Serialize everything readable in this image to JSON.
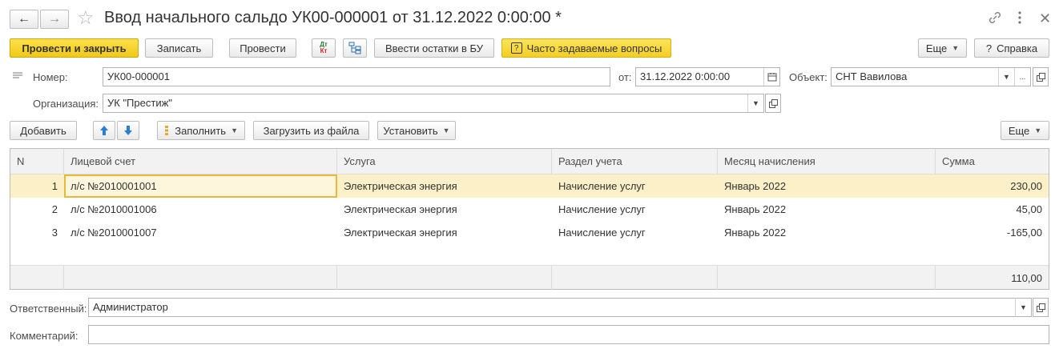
{
  "window": {
    "title": "Ввод начального сальдо УК00-000001 от 31.12.2022 0:00:00 *"
  },
  "toolbar": {
    "post_close": "Провести и закрыть",
    "write": "Записать",
    "post": "Провести",
    "dt_kt_icon": "dt-kt-icon",
    "structure_icon": "structure-icon",
    "enter_balances": "Ввести остатки в БУ",
    "faq": "Часто задаваемые вопросы",
    "more": "Еще",
    "help": "Справка"
  },
  "header": {
    "number_label": "Номер:",
    "number_value": "УК00-000001",
    "from_label": "от:",
    "date_value": "31.12.2022  0:00:00",
    "object_label": "Объект:",
    "object_value": "СНТ Вавилова",
    "org_label": "Организация:",
    "org_value": "УК \"Престиж\""
  },
  "table_toolbar": {
    "add": "Добавить",
    "fill": "Заполнить",
    "load_file": "Загрузить из файла",
    "set": "Установить",
    "more": "Еще"
  },
  "table": {
    "columns": [
      "N",
      "Лицевой счет",
      "Услуга",
      "Раздел учета",
      "Месяц начисления",
      "Сумма"
    ],
    "rows": [
      {
        "n": "1",
        "account": "л/с №2010001001",
        "service": "Электрическая энергия",
        "section": "Начисление услуг",
        "month": "Январь 2022",
        "sum": "230,00"
      },
      {
        "n": "2",
        "account": "л/с №2010001006",
        "service": "Электрическая энергия",
        "section": "Начисление услуг",
        "month": "Январь 2022",
        "sum": "45,00"
      },
      {
        "n": "3",
        "account": "л/с №2010001007",
        "service": "Электрическая энергия",
        "section": "Начисление услуг",
        "month": "Январь 2022",
        "sum": "-165,00"
      }
    ],
    "total": "110,00"
  },
  "footer": {
    "responsible_label": "Ответственный:",
    "responsible_value": "Администратор",
    "comment_label": "Комментарий:",
    "comment_value": ""
  },
  "colors": {
    "primary_button": "#f0c817",
    "selected_row": "#fbf0c8",
    "selected_cell_border": "#e8b83a"
  }
}
